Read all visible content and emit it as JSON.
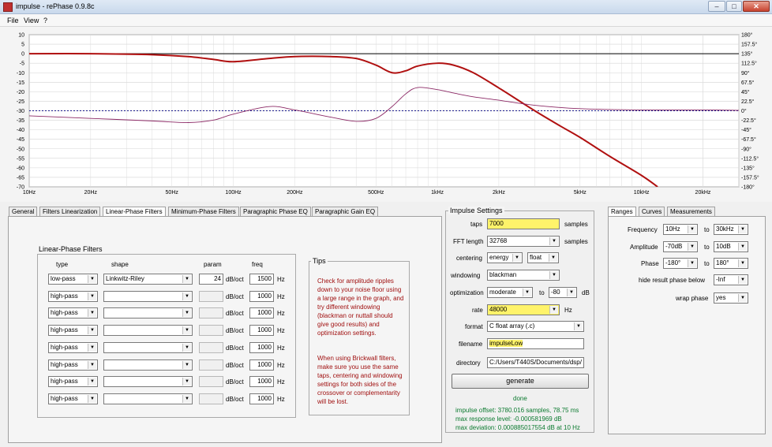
{
  "window": {
    "title": "impulse  -  rePhase 0.9.8c",
    "buttons": {
      "minimize": "–",
      "maximize": "□",
      "close": "✕"
    }
  },
  "menu": [
    "File",
    "View",
    "?"
  ],
  "graph": {
    "amp_ticks": [
      "10",
      "5",
      "0",
      "-5",
      "-10",
      "-15",
      "-20",
      "-25",
      "-30",
      "-35",
      "-40",
      "-45",
      "-50",
      "-55",
      "-60",
      "-65",
      "-70"
    ],
    "phase_ticks": [
      "180°",
      "157.5°",
      "135°",
      "112.5°",
      "90°",
      "67.5°",
      "45°",
      "22.5°",
      "0°",
      "-22.5°",
      "-45°",
      "-67.5°",
      "-90°",
      "-112.5°",
      "-135°",
      "-157.5°",
      "-180°"
    ],
    "freq_ticks": [
      "10Hz",
      "20Hz",
      "50Hz",
      "100Hz",
      "200Hz",
      "500Hz",
      "1kHz",
      "2kHz",
      "5kHz",
      "10kHz",
      "20kHz"
    ],
    "colors": {
      "amplitude": "#b01010",
      "phase": "#8c2a66",
      "zero": "#000000",
      "phase_zero": "#1a1a8c"
    }
  },
  "chart_data": {
    "type": "line",
    "x_scale": "log",
    "x_range_hz": [
      10,
      30000
    ],
    "y_range_db": [
      -70,
      10
    ],
    "y2_range_deg": [
      -180,
      180
    ],
    "grid": true,
    "series": [
      {
        "axis": "db",
        "x": [
          10,
          20,
          40,
          60,
          80,
          100,
          150,
          200,
          300,
          400,
          500,
          600,
          700,
          800,
          1000,
          1200,
          1500,
          2000,
          3000,
          4000,
          5000,
          7000,
          10000,
          12000
        ],
        "y": [
          0,
          0,
          -0.5,
          -1.5,
          -3,
          -4.2,
          -2.5,
          -1.5,
          -1.5,
          -2.5,
          -6,
          -10,
          -9,
          -6.5,
          -5,
          -6,
          -10,
          -18,
          -30,
          -38,
          -44,
          -54,
          -64,
          -70
        ]
      },
      {
        "axis": "deg",
        "x": [
          10,
          20,
          40,
          60,
          80,
          100,
          150,
          200,
          300,
          400,
          500,
          600,
          700,
          800,
          1000,
          1200,
          1500,
          2000,
          3000,
          5000,
          10000,
          20000,
          30000
        ],
        "y": [
          -12,
          -18,
          -24,
          -28,
          -22,
          -8,
          10,
          2,
          -15,
          -25,
          -18,
          10,
          40,
          55,
          50,
          42,
          33,
          25,
          13,
          5,
          2,
          2,
          1
        ]
      }
    ]
  },
  "left_tabs": [
    "General",
    "Filters Linearization",
    "Linear-Phase Filters",
    "Minimum-Phase Filters",
    "Paragraphic Phase EQ",
    "Paragraphic Gain EQ"
  ],
  "filters": {
    "title": "Linear-Phase Filters",
    "headers": {
      "type": "type",
      "shape": "shape",
      "param": "param",
      "freq": "freq"
    },
    "unit_slope": "dB/oct",
    "unit_freq": "Hz",
    "rows": [
      {
        "type": "low-pass",
        "shape": "Linkwitz-Riley",
        "param": "24",
        "freq": "1500"
      },
      {
        "type": "high-pass",
        "shape": "",
        "param": "",
        "freq": "1000"
      },
      {
        "type": "high-pass",
        "shape": "",
        "param": "",
        "freq": "1000"
      },
      {
        "type": "high-pass",
        "shape": "",
        "param": "",
        "freq": "1000"
      },
      {
        "type": "high-pass",
        "shape": "",
        "param": "",
        "freq": "1000"
      },
      {
        "type": "high-pass",
        "shape": "",
        "param": "",
        "freq": "1000"
      },
      {
        "type": "high-pass",
        "shape": "",
        "param": "",
        "freq": "1000"
      },
      {
        "type": "high-pass",
        "shape": "",
        "param": "",
        "freq": "1000"
      }
    ]
  },
  "tips": {
    "title": "Tips",
    "p1": "Check for amplitude ripples down to your noise floor using a large range in the graph, and try different windowing (blackman or nuttall should give good results) and optimization settings.",
    "p2": "When using Brickwall filters, make sure you use the same taps, centering and windowing settings for both sides of the crossover or complementarity will be lost."
  },
  "impulse": {
    "title": "Impulse Settings",
    "taps_label": "taps",
    "taps": "7000",
    "taps_unit": "samples",
    "fft_label": "FFT length",
    "fft": "32768",
    "fft_unit": "samples",
    "centering_label": "centering",
    "centering": "energy",
    "centering2": "float",
    "windowing_label": "windowing",
    "windowing": "blackman",
    "optimization_label": "optimization",
    "optimization": "moderate",
    "opt_to": "to",
    "opt_db": "-80",
    "opt_unit": "dB",
    "rate_label": "rate",
    "rate": "48000",
    "rate_unit": "Hz",
    "format_label": "format",
    "format": "C float array (.c)",
    "filename_label": "filename",
    "filename": "impulseLow",
    "directory_label": "directory",
    "directory": "C:/Users/T440S/Documents/dsp/",
    "generate": "generate",
    "status": "done",
    "offset": "impulse offset: 3780.016 samples, 78.75 ms",
    "response_level": "max response level: -0.000581969 dB",
    "deviation": "max deviation: 0.000885017554 dB at 10 Hz"
  },
  "right_tabs": [
    "Ranges",
    "Curves",
    "Measurements"
  ],
  "ranges": {
    "frequency_label": "Frequency",
    "freq_min": "10Hz",
    "freq_to": "to",
    "freq_max": "30kHz",
    "amplitude_label": "Amplitude",
    "amp_min": "-70dB",
    "amp_to": "to",
    "amp_max": "10dB",
    "phase_label": "Phase",
    "phase_min": "-180°",
    "phase_to": "to",
    "phase_max": "180°",
    "hide_label": "hide result phase below",
    "hide": "-Inf",
    "wrap_label": "wrap phase",
    "wrap": "yes"
  }
}
